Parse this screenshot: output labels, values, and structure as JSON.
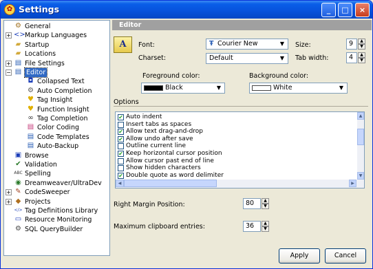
{
  "window": {
    "title": "Settings",
    "min_glyph": "_",
    "max_glyph": "□",
    "close_glyph": "×",
    "app_glyph": "✿"
  },
  "tree": {
    "items": [
      {
        "label": "General",
        "icon": "gear-icon",
        "glyph": "⚙",
        "color": "#a07020"
      },
      {
        "label": "Markup Languages",
        "icon": "code-brackets-icon",
        "glyph": "<>",
        "color": "#1d3fb8",
        "expander": "+"
      },
      {
        "label": "Startup",
        "icon": "folder-icon",
        "glyph": "▰",
        "color": "#d2a93a"
      },
      {
        "label": "Locations",
        "icon": "folder-icon",
        "glyph": "▰",
        "color": "#d2a93a"
      },
      {
        "label": "File Settings",
        "icon": "files-icon",
        "glyph": "▤",
        "color": "#2b5fb5",
        "expander": "+"
      },
      {
        "label": "Editor",
        "icon": "editor-doc-icon",
        "glyph": "▤",
        "color": "#2b5fb5",
        "expander": "−",
        "selected": true
      },
      {
        "label": "Collapsed Text",
        "icon": "collapse-icon",
        "glyph": "◘",
        "color": "#1d3fb8"
      },
      {
        "label": "Auto Completion",
        "icon": "auto-complete-icon",
        "glyph": "⚙",
        "color": "#5a5a5a"
      },
      {
        "label": "Tag Insight",
        "icon": "bulb-icon",
        "glyph": "♥",
        "color": "#e0b000"
      },
      {
        "label": "Function Insight",
        "icon": "bulb-icon",
        "glyph": "♥",
        "color": "#e0b000"
      },
      {
        "label": "Tag Completion",
        "icon": "binoculars-icon",
        "glyph": "∞",
        "color": "#333333"
      },
      {
        "label": "Color Coding",
        "icon": "color-doc-icon",
        "glyph": "▤",
        "color": "#c43b7a"
      },
      {
        "label": "Code Templates",
        "icon": "template-icon",
        "glyph": "▤",
        "color": "#2b5fb5"
      },
      {
        "label": "Auto-Backup",
        "icon": "backup-icon",
        "glyph": "▤",
        "color": "#2b5fb5"
      },
      {
        "label": "Browse",
        "icon": "browse-icon",
        "glyph": "▣",
        "color": "#1d3fb8"
      },
      {
        "label": "Validation",
        "icon": "validation-icon",
        "glyph": "✔",
        "color": "#2a7a2a"
      },
      {
        "label": "Spelling",
        "icon": "spelling-icon",
        "glyph": "ABC",
        "color": "#333333"
      },
      {
        "label": "Dreamweaver/UltraDev",
        "icon": "dreamweaver-icon",
        "glyph": "◉",
        "color": "#2a7a2a"
      },
      {
        "label": "CodeSweeper",
        "icon": "broom-icon",
        "glyph": "✎",
        "color": "#a04020",
        "expander": "+"
      },
      {
        "label": "Projects",
        "icon": "projects-icon",
        "glyph": "◆",
        "color": "#b07020",
        "expander": "+"
      },
      {
        "label": "Tag Definitions Library",
        "icon": "tag-library-icon",
        "glyph": "</>",
        "color": "#1d3fb8"
      },
      {
        "label": "Resource Monitoring",
        "icon": "monitor-icon",
        "glyph": "▭",
        "color": "#1d3fb8"
      },
      {
        "label": "SQL QueryBuilder",
        "icon": "query-builder-icon",
        "glyph": "⚙",
        "color": "#4a4a4a"
      }
    ]
  },
  "editor": {
    "header": "Editor",
    "font_icon_glyph": "A",
    "font_label": "Font:",
    "font_value": "Courier New",
    "font_type_glyph": "Ŧ",
    "charset_label": "Charset:",
    "charset_value": "Default",
    "size_label": "Size:",
    "size_value": "9",
    "tab_width_label": "Tab width:",
    "tab_width_value": "4",
    "fg_label": "Foreground color:",
    "fg_value": "Black",
    "fg_color": "#000000",
    "bg_label": "Background color:",
    "bg_value": "White",
    "bg_color": "#ffffff",
    "options_label": "Options",
    "options": [
      {
        "label": "Auto indent",
        "checked": true
      },
      {
        "label": "Insert tabs as spaces",
        "checked": false
      },
      {
        "label": "Allow text drag-and-drop",
        "checked": true
      },
      {
        "label": "Allow undo after save",
        "checked": true
      },
      {
        "label": "Outline current line",
        "checked": false
      },
      {
        "label": "Keep horizontal cursor position",
        "checked": true
      },
      {
        "label": "Allow cursor past end of line",
        "checked": false
      },
      {
        "label": "Show hidden characters",
        "checked": false
      },
      {
        "label": "Double quote as word delimiter",
        "checked": true
      }
    ],
    "check_glyph": "✔",
    "right_margin_label": "Right Margin Position:",
    "right_margin_value": "80",
    "clipboard_label": "Maximum clipboard entries:",
    "clipboard_value": "36"
  },
  "buttons": {
    "apply": "Apply",
    "cancel": "Cancel"
  }
}
